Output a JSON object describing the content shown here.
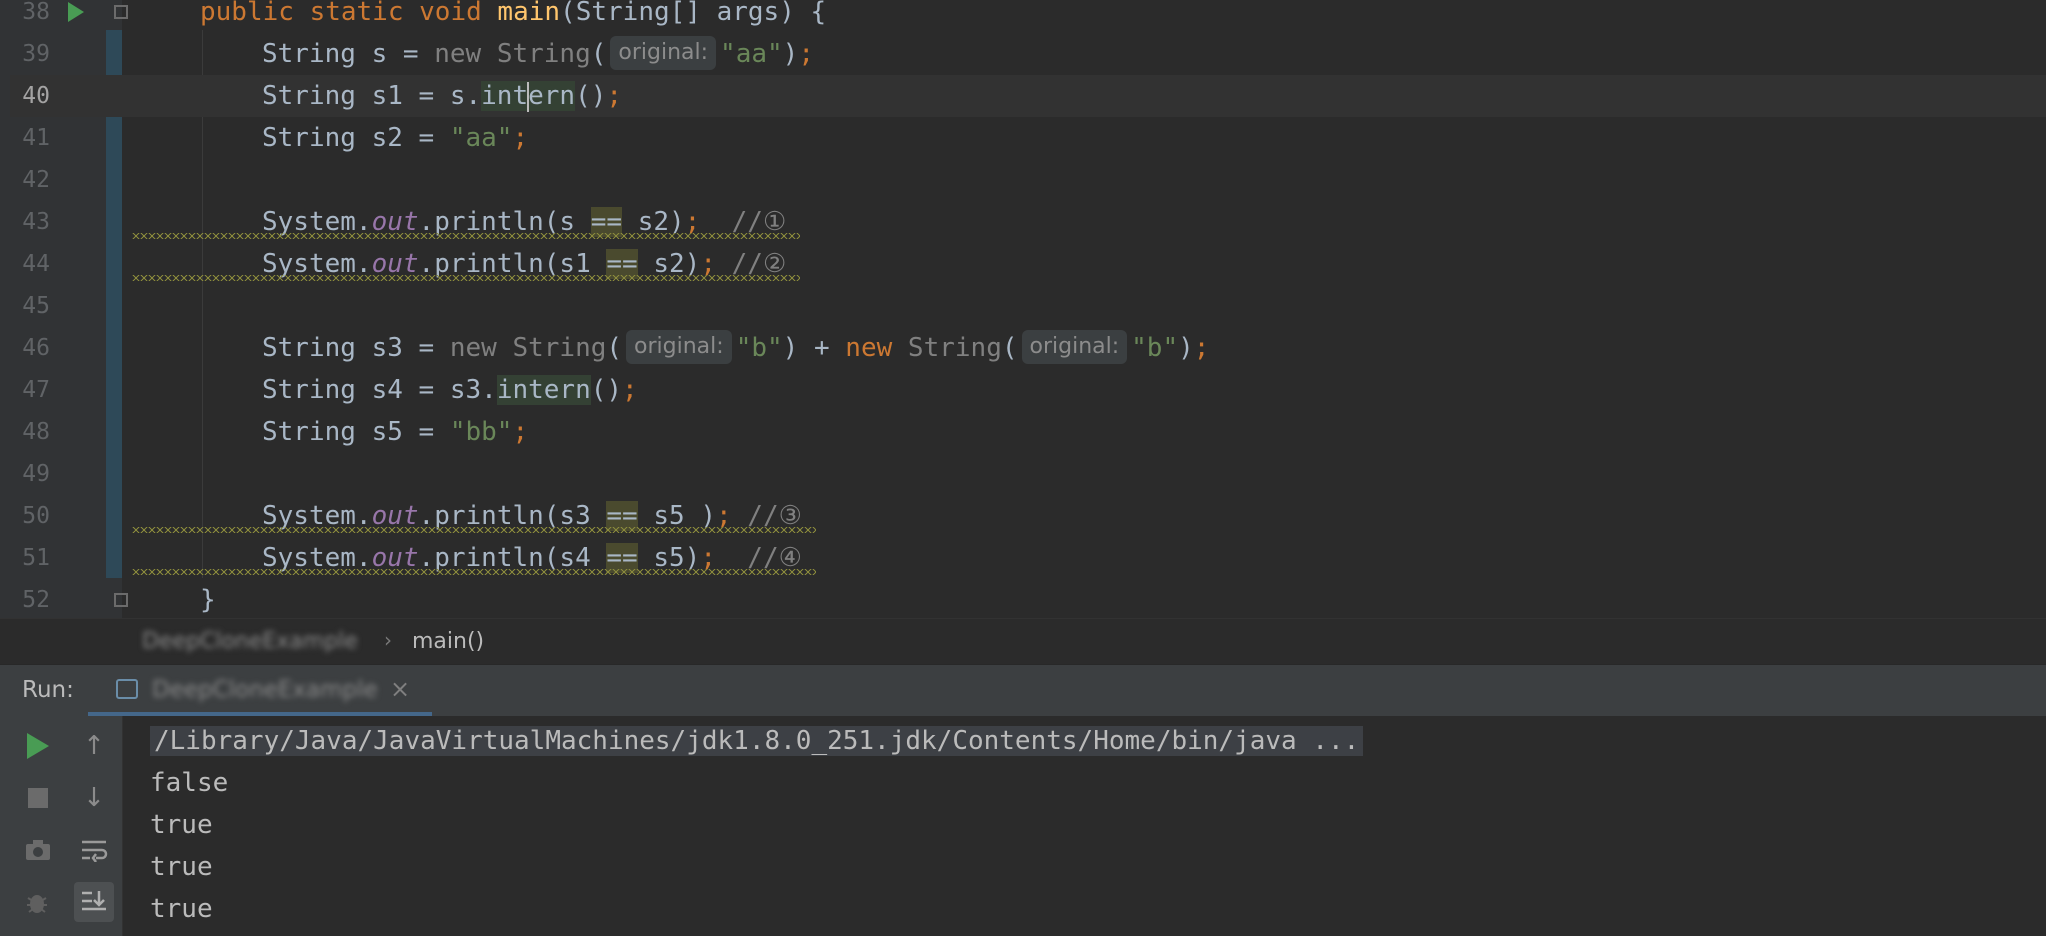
{
  "editor": {
    "lines": [
      {
        "num": "38",
        "tokens": [
          [
            "kw",
            "public static void "
          ],
          [
            "fn",
            "main"
          ],
          [
            "cls",
            "(String[] args) {"
          ]
        ]
      },
      {
        "num": "39",
        "tokens": [
          [
            "cls",
            "String s = "
          ],
          [
            "new",
            "new "
          ],
          [
            "new",
            "String"
          ],
          [
            "cls",
            "("
          ],
          [
            "hint",
            "original:"
          ],
          [
            "str",
            "\"aa\""
          ],
          [
            "cls",
            ")"
          ],
          [
            "semi",
            ";"
          ]
        ]
      },
      {
        "num": "40",
        "current": true
      },
      {
        "num": "41",
        "tokens": [
          [
            "cls",
            "String s2 = "
          ],
          [
            "str",
            "\"aa\""
          ],
          [
            "semi",
            ";"
          ]
        ]
      },
      {
        "num": "42",
        "tokens": []
      },
      {
        "num": "43",
        "tokens": [
          [
            "cls",
            "System."
          ],
          [
            "fld",
            "out"
          ],
          [
            "cls",
            ".println(s "
          ],
          [
            "eq",
            "=="
          ],
          [
            "cls",
            " s2)"
          ],
          [
            "semi",
            ";"
          ],
          [
            "cmt",
            "  //①"
          ]
        ]
      },
      {
        "num": "44",
        "tokens": [
          [
            "cls",
            "System."
          ],
          [
            "fld",
            "out"
          ],
          [
            "cls",
            ".println(s1 "
          ],
          [
            "eq",
            "=="
          ],
          [
            "cls",
            " s2)"
          ],
          [
            "semi",
            ";"
          ],
          [
            "cmt",
            " //②"
          ]
        ]
      },
      {
        "num": "45",
        "tokens": []
      },
      {
        "num": "46",
        "tokens": [
          [
            "cls",
            "String s3 = "
          ],
          [
            "new",
            "new "
          ],
          [
            "new",
            "String"
          ],
          [
            "cls",
            "("
          ],
          [
            "hint",
            "original:"
          ],
          [
            "str",
            "\"b\""
          ],
          [
            "cls",
            ") + "
          ],
          [
            "kw2",
            "new "
          ],
          [
            "new",
            "String"
          ],
          [
            "cls",
            "("
          ],
          [
            "hint",
            "original:"
          ],
          [
            "str",
            "\"b\""
          ],
          [
            "cls",
            ")"
          ],
          [
            "semi",
            ";"
          ]
        ]
      },
      {
        "num": "47",
        "tokens": [
          [
            "cls",
            "String s4 = s3."
          ],
          [
            "mhl",
            "intern"
          ],
          [
            "cls",
            "()"
          ],
          [
            "semi",
            ";"
          ]
        ]
      },
      {
        "num": "48",
        "tokens": [
          [
            "cls",
            "String s5 = "
          ],
          [
            "str",
            "\"bb\""
          ],
          [
            "semi",
            ";"
          ]
        ]
      },
      {
        "num": "49",
        "tokens": []
      },
      {
        "num": "50",
        "tokens": [
          [
            "cls",
            "System."
          ],
          [
            "fld",
            "out"
          ],
          [
            "cls",
            ".println(s3 "
          ],
          [
            "eq",
            "=="
          ],
          [
            "cls",
            " s5 )"
          ],
          [
            "semi",
            ";"
          ],
          [
            "cmt",
            " //③"
          ]
        ]
      },
      {
        "num": "51",
        "tokens": [
          [
            "cls",
            "System."
          ],
          [
            "fld",
            "out"
          ],
          [
            "cls",
            ".println(s4 "
          ],
          [
            "eq",
            "=="
          ],
          [
            "cls",
            " s5)"
          ],
          [
            "semi",
            ";"
          ],
          [
            "cmt",
            "  //④"
          ]
        ]
      },
      {
        "num": "52",
        "tokens": [
          [
            "cls",
            "}"
          ]
        ]
      }
    ],
    "line40": {
      "pre": "String s1 = s.",
      "hl_a": "int",
      "hl_b": "ern",
      "post": "()",
      "semi": ";"
    }
  },
  "breadcrumb": {
    "class_name": "DeepCloneExample",
    "method": "main()"
  },
  "run": {
    "label": "Run:",
    "tab_name": "DeepCloneExample",
    "close": "×",
    "console": [
      "/Library/Java/JavaVirtualMachines/jdk1.8.0_251.jdk/Contents/Home/bin/java ...",
      "false",
      "true",
      "true",
      "true"
    ]
  },
  "colors": {
    "background": "#2b2b2b",
    "keyword": "#cc7832",
    "method": "#ffc66d",
    "string": "#6a8759",
    "field": "#9876aa",
    "run_green": "#499c54"
  }
}
